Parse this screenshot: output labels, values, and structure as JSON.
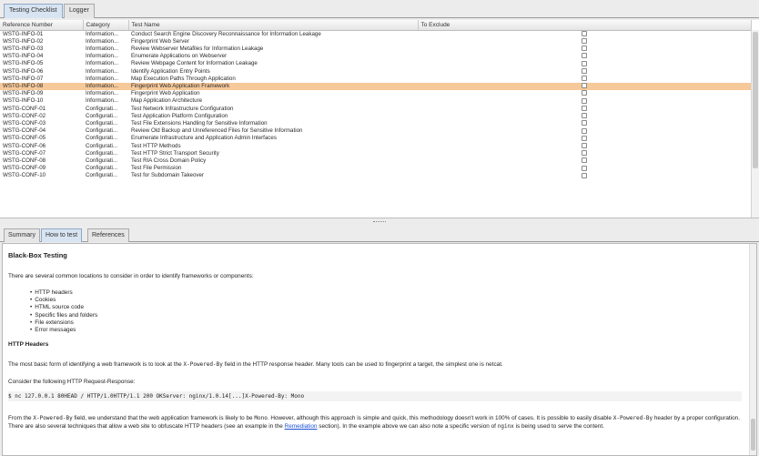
{
  "tabs": {
    "checklist": "Testing Checklist",
    "logger": "Logger"
  },
  "table": {
    "columns": [
      "Reference Number",
      "Category",
      "Test Name",
      "To Exclude"
    ],
    "rows": [
      {
        "ref": "WSTG-INFO-01",
        "cat": "Information...",
        "name": "Conduct Search Engine Discovery Reconnaissance for Information Leakage"
      },
      {
        "ref": "WSTG-INFO-02",
        "cat": "Information...",
        "name": "Fingerprint Web Server"
      },
      {
        "ref": "WSTG-INFO-03",
        "cat": "Information...",
        "name": "Review Webserver Metafiles for Information Leakage"
      },
      {
        "ref": "WSTG-INFO-04",
        "cat": "Information...",
        "name": "Enumerate Applications on Webserver"
      },
      {
        "ref": "WSTG-INFO-05",
        "cat": "Information...",
        "name": "Review Webpage Content for Information Leakage"
      },
      {
        "ref": "WSTG-INFO-06",
        "cat": "Information...",
        "name": "Identify Application Entry Points"
      },
      {
        "ref": "WSTG-INFO-07",
        "cat": "Information...",
        "name": "Map Execution Paths Through Application"
      },
      {
        "ref": "WSTG-INFO-08",
        "cat": "Information...",
        "name": "Fingerprint Web Application Framework"
      },
      {
        "ref": "WSTG-INFO-09",
        "cat": "Information...",
        "name": "Fingerprint Web Application"
      },
      {
        "ref": "WSTG-INFO-10",
        "cat": "Information...",
        "name": "Map Application Architecture"
      },
      {
        "ref": "WSTG-CONF-01",
        "cat": "Configurati...",
        "name": "Test Network Infrastructure Configuration"
      },
      {
        "ref": "WSTG-CONF-02",
        "cat": "Configurati...",
        "name": "Test Application Platform Configuration"
      },
      {
        "ref": "WSTG-CONF-03",
        "cat": "Configurati...",
        "name": "Test File Extensions Handling for Sensitive Information"
      },
      {
        "ref": "WSTG-CONF-04",
        "cat": "Configurati...",
        "name": "Review Old Backup and Unreferenced Files for Sensitive Information"
      },
      {
        "ref": "WSTG-CONF-05",
        "cat": "Configurati...",
        "name": "Enumerate Infrastructure and Application Admin Interfaces"
      },
      {
        "ref": "WSTG-CONF-06",
        "cat": "Configurati...",
        "name": "Test HTTP Methods"
      },
      {
        "ref": "WSTG-CONF-07",
        "cat": "Configurati...",
        "name": "Test HTTP Strict Transport Security"
      },
      {
        "ref": "WSTG-CONF-08",
        "cat": "Configurati...",
        "name": "Test RIA Cross Domain Policy"
      },
      {
        "ref": "WSTG-CONF-09",
        "cat": "Configurati...",
        "name": "Test File Permission"
      },
      {
        "ref": "WSTG-CONF-10",
        "cat": "Configurati...",
        "name": "Test for Subdomain Takeover"
      }
    ],
    "selected_row": "WSTG-INFO-08",
    "selected_color": "#f6c99a"
  },
  "bottom_tabs": {
    "summary": "Summary",
    "how": "How to test",
    "refs": "References"
  },
  "content": {
    "heading": "Black-Box Testing",
    "intro": "There are several common locations to consider in order to identify frameworks or components:",
    "bullets": [
      "HTTP headers",
      "Cookies",
      "HTML source code",
      "Specific files and folders",
      "File extensions",
      "Error messages"
    ],
    "sub_heading": "HTTP Headers",
    "p1_a": "The most basic form of identifying a web framework is to look at the ",
    "p1_code": "X-Powered-By",
    "p1_b": " field in the HTTP response header. Many tools can be used to fingerprint a target, the simplest one is netcat.",
    "p2": "Consider the following HTTP Request-Response:",
    "code_line": "$ nc 127.0.0.1 80HEAD / HTTP/1.0HTTP/1.1 200 OKServer: nginx/1.0.14[...]X-Powered-By: Mono",
    "p3_a": "From the ",
    "p3_code1": "X-Powered-By",
    "p3_b": " field, we understand that the web application framework is likely to be ",
    "p3_code2": "Mono",
    "p3_c": ". However, although this approach is simple and quick, this methodology doesn't work in 100% of cases. It is possible to easily disable ",
    "p3_code3": "X-Powered-By",
    "p3_d": " header by a proper configuration. There are also several techniques that allow a web site to obfuscate HTTP headers (see an example in the ",
    "p3_link": "Remediation",
    "p3_e": " section). In the example above we can also note a specific version of ",
    "p3_code4": "nginx",
    "p3_f": " is being used to serve the content."
  }
}
